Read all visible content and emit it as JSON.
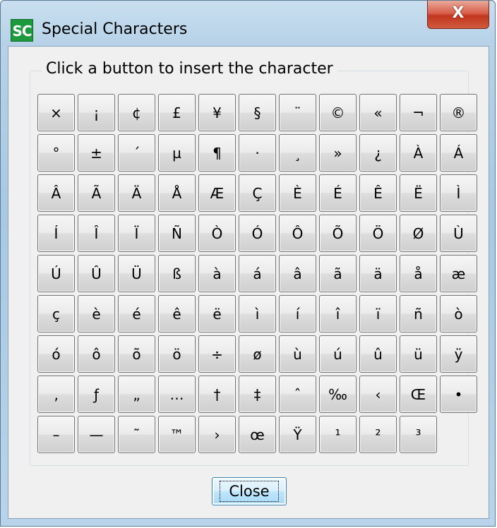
{
  "window": {
    "title": "Special Characters",
    "icon_text": "SC",
    "close_glyph": "X"
  },
  "group": {
    "label": "Click a button to insert the character"
  },
  "characters": [
    "×",
    "¡",
    "¢",
    "£",
    "¥",
    "§",
    "¨",
    "©",
    "«",
    "¬",
    "®",
    "°",
    "±",
    "´",
    "µ",
    "¶",
    "·",
    "¸",
    "»",
    "¿",
    "À",
    "Á",
    "Â",
    "Ã",
    "Ä",
    "Å",
    "Æ",
    "Ç",
    "È",
    "É",
    "Ê",
    "Ë",
    "Ì",
    "Í",
    "Î",
    "Ï",
    "Ñ",
    "Ò",
    "Ó",
    "Ô",
    "Õ",
    "Ö",
    "Ø",
    "Ù",
    "Ú",
    "Û",
    "Ü",
    "ß",
    "à",
    "á",
    "â",
    "ã",
    "ä",
    "å",
    "æ",
    "ç",
    "è",
    "é",
    "ê",
    "ë",
    "ì",
    "í",
    "î",
    "ï",
    "ñ",
    "ò",
    "ó",
    "ô",
    "õ",
    "ö",
    "÷",
    "ø",
    "ù",
    "ú",
    "û",
    "ü",
    "ÿ",
    "‚",
    "ƒ",
    "„",
    "…",
    "†",
    "‡",
    "ˆ",
    "‰",
    "‹",
    "Œ",
    "•",
    "–",
    "—",
    "˜",
    "™",
    "›",
    "œ",
    "Ÿ",
    "¹",
    "²",
    "³"
  ],
  "buttons": {
    "close_label": "Close"
  }
}
